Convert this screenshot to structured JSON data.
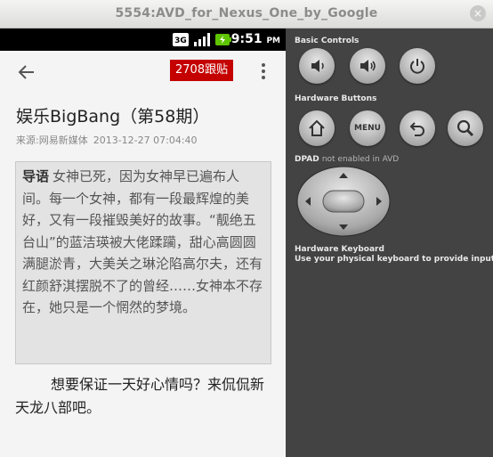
{
  "window": {
    "title": "5554:AVD_for_Nexus_One_by_Google",
    "close_glyph": "×"
  },
  "statusbar": {
    "time": "9:51",
    "ampm": "PM",
    "icons": [
      "3g-icon",
      "signal-icon",
      "battery-icon"
    ]
  },
  "appbar": {
    "comment_count_label": "2708跟贴"
  },
  "article": {
    "title": "娱乐BigBang（第58期）",
    "source": "来源:网易新媒体",
    "timestamp": "2013-12-27 07:04:40",
    "summary_lead": "导语",
    "summary_text": "女神已死，因为女神早已遍布人间。每一个女神，都有一段最辉煌的美好，又有一段摧毁美好的故事。“靓绝五台山”的蓝洁瑛被大佬蹂躏，甜心高圆圆满腿淤青，大美关之琳沦陷高尔夫，还有红颜舒淇摆脱不了的曾经……女神本不存在，她只是一个惘然的梦境。",
    "body": "想要保证一天好心情吗？来侃侃新天龙八部吧。"
  },
  "controls": {
    "basic_label": "Basic Controls",
    "hardware_label": "Hardware Buttons",
    "menu_label": "MENU",
    "dpad_label": "DPAD",
    "dpad_note": "not enabled in AVD",
    "keyboard_label": "Hardware Keyboard",
    "keyboard_desc": "Use your physical keyboard to provide input"
  },
  "colors": {
    "accent": "#c40000",
    "panel": "#434343",
    "statusbar": "#000000"
  }
}
